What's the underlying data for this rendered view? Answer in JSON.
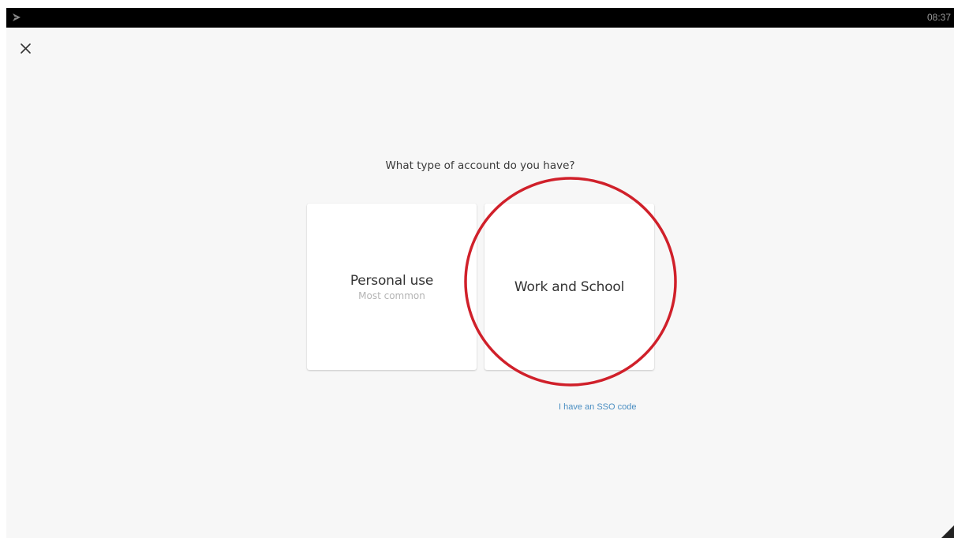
{
  "status_bar": {
    "app_icon": "app-logo-icon",
    "time": "08:37"
  },
  "header": {
    "close_icon": "close-icon"
  },
  "main": {
    "question": "What type of account do you have?",
    "options": [
      {
        "title": "Personal use",
        "subtitle": "Most common"
      },
      {
        "title": "Work and School"
      }
    ],
    "sso_link": "I have an SSO code"
  },
  "annotation": {
    "shape": "circle",
    "color": "#d0202a",
    "target": "Work and School"
  },
  "colors": {
    "background": "#f7f7f7",
    "link": "#4a8ec2",
    "status_bar": "#000000"
  }
}
